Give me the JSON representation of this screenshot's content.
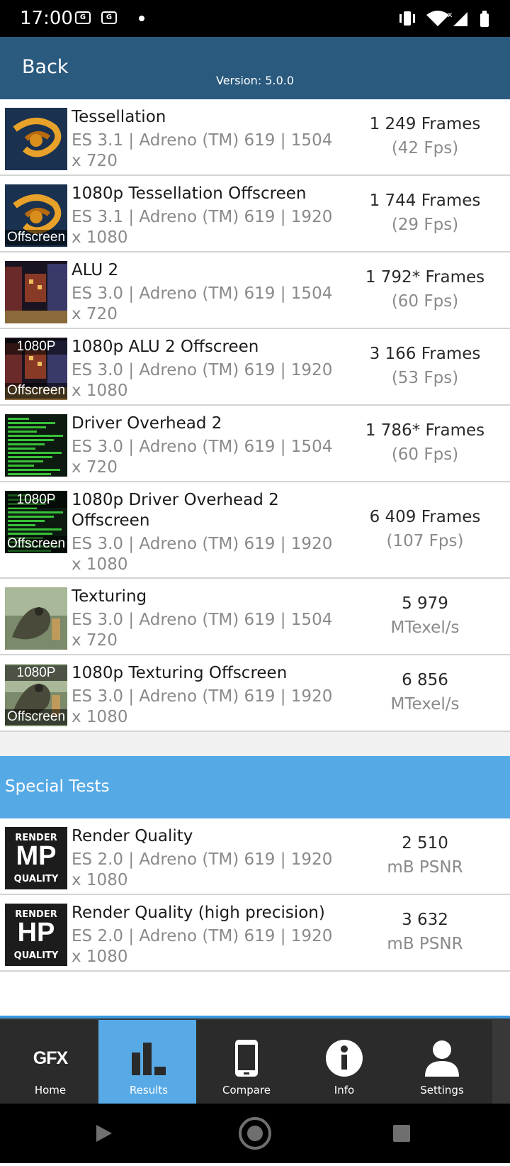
{
  "status": {
    "time": "17:00",
    "icons": [
      "gmail-icon",
      "gmail-icon",
      "dot-icon",
      "vibrate-icon",
      "wifi-icon",
      "signal-icon",
      "battery-icon"
    ]
  },
  "header": {
    "back_label": "Back",
    "version": "Version: 5.0.0",
    "bg_color": "#2a5a7e"
  },
  "tests": [
    {
      "name": "Tessellation",
      "sub": "ES 3.1 | Adreno (TM) 619 | 1504 x 720",
      "score": "1 249 Frames",
      "unit": "(42 Fps)",
      "thumb": "tessellation",
      "badge_top": "",
      "badge_bottom": ""
    },
    {
      "name": "1080p Tessellation Offscreen",
      "sub": "ES 3.1 | Adreno (TM) 619 | 1920 x 1080",
      "score": "1 744 Frames",
      "unit": "(29 Fps)",
      "thumb": "tessellation",
      "badge_top": "",
      "badge_bottom": "Offscreen"
    },
    {
      "name": "ALU 2",
      "sub": "ES 3.0 | Adreno (TM) 619 | 1504 x 720",
      "score": "1 792* Frames",
      "unit": "(60 Fps)",
      "thumb": "alu",
      "badge_top": "",
      "badge_bottom": ""
    },
    {
      "name": "1080p ALU 2 Offscreen",
      "sub": "ES 3.0 | Adreno (TM) 619 | 1920 x 1080",
      "score": "3 166 Frames",
      "unit": "(53 Fps)",
      "thumb": "alu",
      "badge_top": "1080P",
      "badge_bottom": "Offscreen"
    },
    {
      "name": "Driver Overhead 2",
      "sub": "ES 3.0 | Adreno (TM) 619 | 1504 x 720",
      "score": "1 786* Frames",
      "unit": "(60 Fps)",
      "thumb": "driver",
      "badge_top": "",
      "badge_bottom": ""
    },
    {
      "name": "1080p Driver Overhead 2 Offscreen",
      "sub": "ES 3.0 | Adreno (TM) 619 | 1920 x 1080",
      "score": "6 409 Frames",
      "unit": "(107 Fps)",
      "thumb": "driver",
      "badge_top": "1080P",
      "badge_bottom": "Offscreen"
    },
    {
      "name": "Texturing",
      "sub": "ES 3.0 | Adreno (TM) 619 | 1504 x 720",
      "score": "5 979",
      "unit": "MTexel/s",
      "thumb": "texturing",
      "badge_top": "",
      "badge_bottom": ""
    },
    {
      "name": "1080p Texturing Offscreen",
      "sub": "ES 3.0 | Adreno (TM) 619 | 1920 x 1080",
      "score": "6 856",
      "unit": "MTexel/s",
      "thumb": "texturing",
      "badge_top": "1080P",
      "badge_bottom": "Offscreen"
    }
  ],
  "special": {
    "title": "Special Tests",
    "color": "#55a9e5",
    "tests": [
      {
        "name": "Render Quality",
        "sub": "ES 2.0 | Adreno (TM) 619 | 1920 x 1080",
        "score": "2 510",
        "unit": "mB PSNR",
        "thumb": "render",
        "badge_top": "RENDER",
        "badge_mid": "MP",
        "badge_bottom": "QUALITY"
      },
      {
        "name": "Render Quality (high precision)",
        "sub": "ES 2.0 | Adreno (TM) 619 | 1920 x 1080",
        "score": "3 632",
        "unit": "mB PSNR",
        "thumb": "render",
        "badge_top": "RENDER",
        "badge_mid": "HP",
        "badge_bottom": "QUALITY"
      }
    ]
  },
  "nav": {
    "active_color": "#58aae6",
    "items": [
      {
        "label": "Home",
        "icon": "gfx-logo-icon",
        "logo_text": "GFX"
      },
      {
        "label": "Results",
        "icon": "bar-chart-icon"
      },
      {
        "label": "Compare",
        "icon": "phone-icon"
      },
      {
        "label": "Info",
        "icon": "info-icon"
      },
      {
        "label": "Settings",
        "icon": "user-icon"
      }
    ],
    "active_index": 1
  }
}
